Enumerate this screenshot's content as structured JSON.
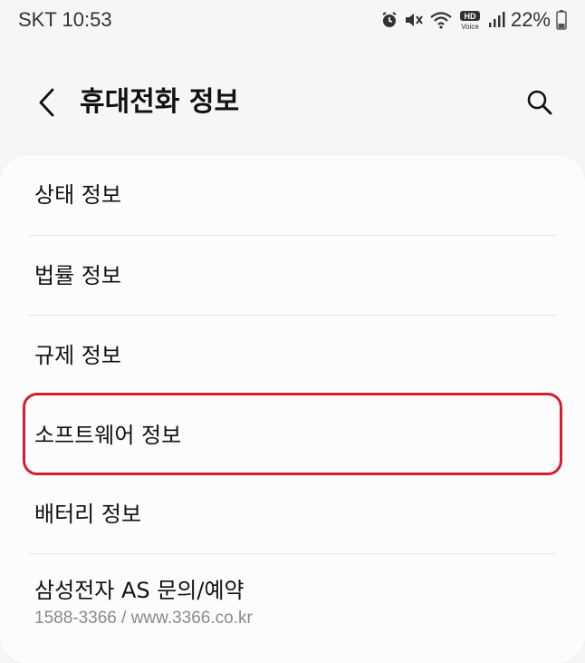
{
  "status_bar": {
    "carrier_time": "SKT 10:53",
    "battery_percent": "22%",
    "icons": [
      "alarm-icon",
      "mute-icon",
      "wifi-icon",
      "hd-voice-icon",
      "signal-icon",
      "battery-icon"
    ],
    "hd_voice_top": "HD",
    "hd_voice_bottom": "Voice"
  },
  "header": {
    "title": "휴대전화 정보",
    "back_icon": "chevron-left-icon",
    "search_icon": "search-icon"
  },
  "menu": {
    "items": [
      {
        "label": "상태 정보"
      },
      {
        "label": "법률 정보"
      },
      {
        "label": "규제 정보"
      },
      {
        "label": "소프트웨어 정보"
      },
      {
        "label": "배터리 정보"
      },
      {
        "label": "삼성전자 AS 문의/예약",
        "sub": "1588-3366 / www.3366.co.kr"
      }
    ]
  },
  "colors": {
    "background": "#f6f6f6",
    "card": "#fcfcfc",
    "highlight": "#d3202f",
    "subtext": "#8a8a8a"
  }
}
